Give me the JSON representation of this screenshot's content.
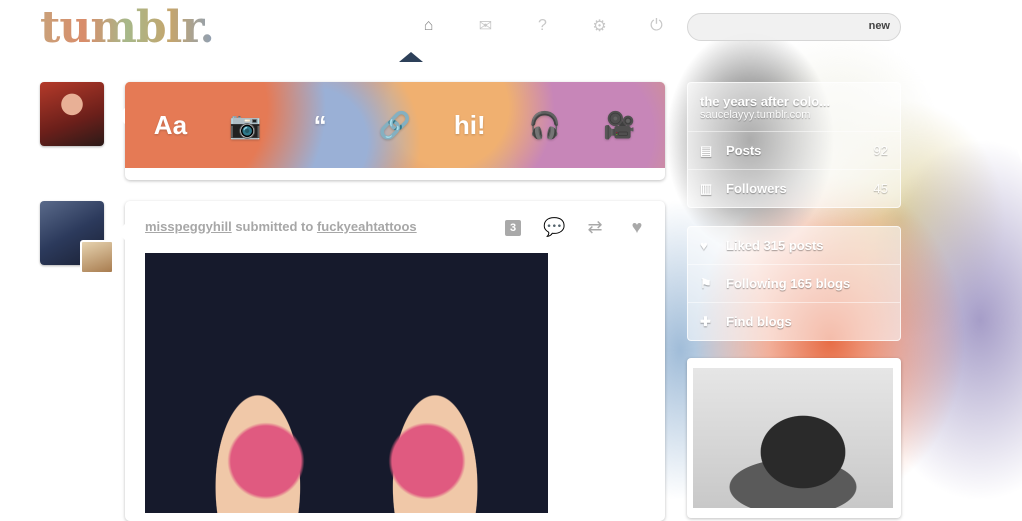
{
  "header": {
    "logo": "tumblr.",
    "nav": [
      {
        "name": "dashboard-icon",
        "glyph": "⌂"
      },
      {
        "name": "inbox-icon",
        "glyph": "✉"
      },
      {
        "name": "help-icon",
        "glyph": "?"
      },
      {
        "name": "settings-icon",
        "glyph": "⚙"
      },
      {
        "name": "logout-icon",
        "glyph": "⏻"
      }
    ],
    "search": {
      "placeholder": "",
      "badge": "new"
    }
  },
  "post_types": [
    {
      "name": "text-post-icon",
      "glyph": "Aa"
    },
    {
      "name": "photo-post-icon",
      "glyph": "📷"
    },
    {
      "name": "quote-post-icon",
      "glyph": "“"
    },
    {
      "name": "link-post-icon",
      "glyph": "🔗"
    },
    {
      "name": "chat-post-icon",
      "glyph": "hi!"
    },
    {
      "name": "audio-post-icon",
      "glyph": "🎧"
    },
    {
      "name": "video-post-icon",
      "glyph": "🎥"
    }
  ],
  "post": {
    "author": "misspeggyhill",
    "action": "submitted to",
    "target": "fuckyeahtattoos",
    "notes": "3"
  },
  "sidebar": {
    "blog_title": "the years after colo...",
    "blog_url": "saucelayyy.tumblr.com",
    "blog_items": [
      {
        "label": "Posts",
        "count": "92"
      },
      {
        "label": "Followers",
        "count": "45"
      }
    ],
    "account_items": [
      {
        "label": "Liked 315 posts"
      },
      {
        "label": "Following 165 blogs"
      },
      {
        "label": "Find blogs"
      }
    ]
  },
  "colors": {
    "nav_caret": "#2d4059",
    "muted_text": "#a7a7a7"
  }
}
